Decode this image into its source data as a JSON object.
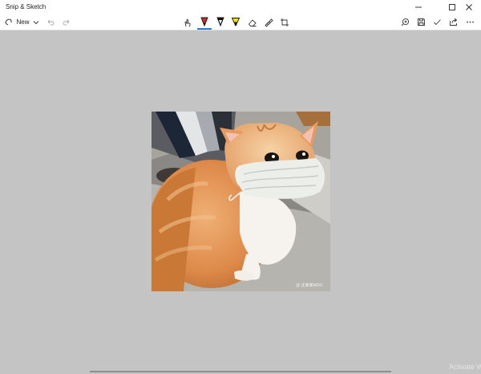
{
  "window": {
    "title": "Snip & Sketch"
  },
  "toolbar": {
    "new_label": "New",
    "tools": [
      "touch-writing",
      "ballpoint-pen",
      "pencil",
      "highlighter",
      "eraser",
      "ruler",
      "image-crop"
    ],
    "right_actions": [
      "zoom",
      "save",
      "copy",
      "share",
      "see-more"
    ]
  },
  "image": {
    "description_icon": "cat-photo",
    "watermark": "@ 沈某某MOO"
  },
  "watermark": {
    "text": "Activate Windo"
  },
  "colors": {
    "canvas_bg": "#c4c4c4",
    "accent": "#2c78d0",
    "ballpoint_pen": "#d32727",
    "highlighter": "#f2e200"
  }
}
